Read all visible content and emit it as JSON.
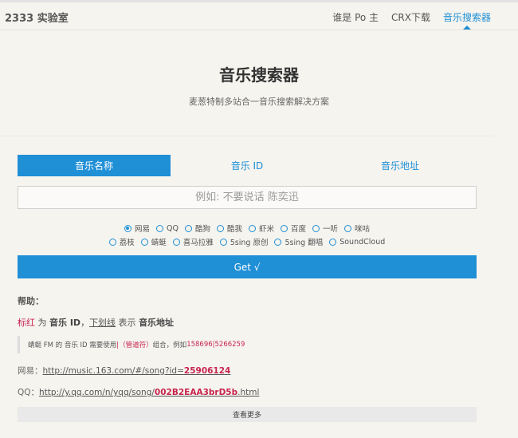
{
  "header": {
    "brand": "2333 实验室",
    "nav": [
      {
        "label": "谁是 Po 主"
      },
      {
        "label": "CRX下载"
      },
      {
        "label": "音乐搜索器"
      }
    ]
  },
  "hero": {
    "title": "音乐搜索器",
    "subtitle": "麦葱特制多站合一音乐搜索解决方案"
  },
  "tabs": [
    {
      "label": "音乐名称"
    },
    {
      "label": "音乐 ID"
    },
    {
      "label": "音乐地址"
    }
  ],
  "search": {
    "placeholder": "例如: 不要说话 陈奕迅"
  },
  "sources_row1": [
    "网易",
    "QQ",
    "酷狗",
    "酷我",
    "虾米",
    "百度",
    "一听",
    "咪咕"
  ],
  "sources_row2": [
    "荔枝",
    "蜻蜓",
    "喜马拉雅",
    "5sing 原创",
    "5sing 翻唱",
    "SoundCloud"
  ],
  "selected_source": "网易",
  "get_button": "Get √",
  "help": {
    "title": "帮助：",
    "red_word": "标红",
    "part1": " 为 ",
    "music_id": "音乐 ID",
    "sep": "，",
    "underline": "下划线",
    "part2": " 表示 ",
    "music_url": "音乐地址",
    "note_prefix": "蜻蜓 FM 的 音乐 ID 需要使用 ",
    "note_pipe": "|（管道符）",
    "note_mid": " 组合，例如 ",
    "note_example": "158696|5266259"
  },
  "examples": [
    {
      "label": "网易：",
      "url_prefix": "http://music.163.com/#/song?id=",
      "id": "25906124",
      "url_suffix": ""
    },
    {
      "label": "QQ：",
      "url_prefix": "http://y.qq.com/n/yqq/song/",
      "id": "002B2EAA3brD5b",
      "url_suffix": ".html"
    }
  ],
  "more_button": "查看更多"
}
